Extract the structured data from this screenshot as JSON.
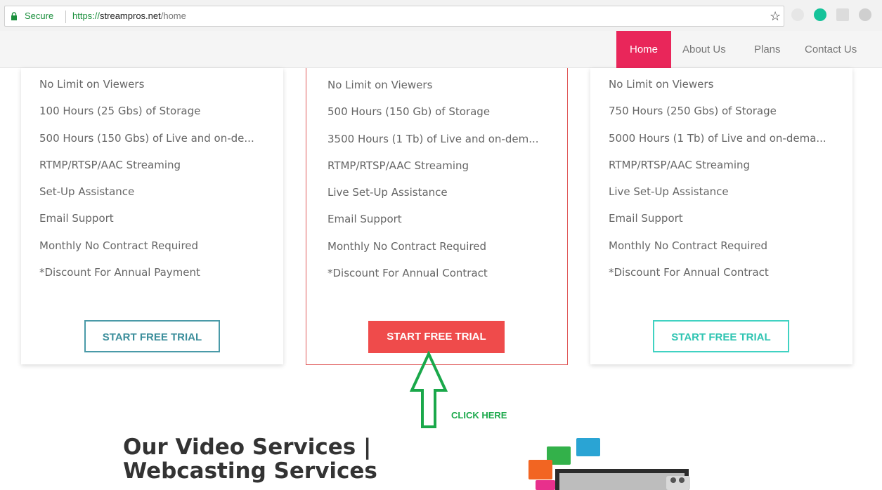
{
  "browser": {
    "secure_label": "Secure",
    "url_protocol": "https://",
    "url_host": "streampros.net",
    "url_path": "/home"
  },
  "nav": {
    "items": [
      {
        "label": "Home",
        "active": true
      },
      {
        "label": "About Us"
      },
      {
        "label": "Plans"
      },
      {
        "label": "Contact Us"
      }
    ],
    "active_color": "#e9265a"
  },
  "plans": [
    {
      "features": [
        "No Limit on Viewers",
        "100 Hours (25 Gbs) of Storage",
        "500 Hours (150 Gbs) of Live and on-de...",
        "RTMP/RTSP/AAC Streaming",
        "Set-Up Assistance",
        "Email Support",
        "Monthly No Contract Required",
        "*Discount For Annual Payment"
      ],
      "button_label": "START FREE TRIAL",
      "button_color": "#4a9aa8"
    },
    {
      "features": [
        "No Limit on Viewers",
        "500 Hours (150 Gb) of Storage",
        "3500 Hours (1 Tb) of Live and on-dem...",
        "RTMP/RTSP/AAC Streaming",
        "Live Set-Up Assistance",
        "Email Support",
        "Monthly No Contract Required",
        "*Discount For Annual Contract"
      ],
      "button_label": "START FREE TRIAL",
      "button_color": "#ef4b4b"
    },
    {
      "features": [
        "No Limit on Viewers",
        "750 Hours (250 Gbs) of Storage",
        "5000 Hours (1 Tb) of Live and on-dema...",
        "RTMP/RTSP/AAC Streaming",
        "Live Set-Up Assistance",
        "Email Support",
        "Monthly No Contract Required",
        "*Discount For Annual Contract"
      ],
      "button_label": "START FREE TRIAL",
      "button_color": "#40d2c2"
    }
  ],
  "annotation": {
    "label": "CLICK HERE",
    "color": "#1aa84a"
  },
  "services": {
    "title_line1": "Our Video Services |",
    "title_line2": "Webcasting Services"
  }
}
